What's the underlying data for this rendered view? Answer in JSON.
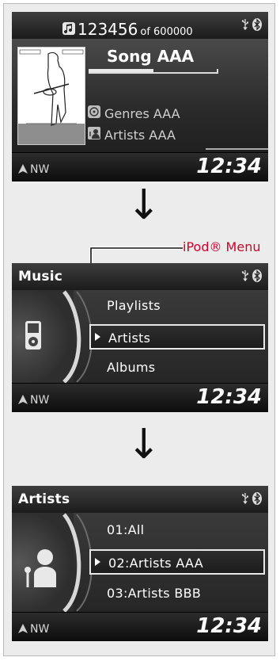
{
  "screens": {
    "now_playing": {
      "track_number": "123456",
      "track_of": "of 600000",
      "song": "Song AAA",
      "genre": "Genres AAA",
      "artist": "Artists AAA",
      "progress": 0.5,
      "compass": "NW",
      "clock": "12:34"
    },
    "music_menu": {
      "title": "Music",
      "items": [
        "Playlists",
        "Artists",
        "Albums"
      ],
      "selected_index": 1,
      "compass": "NW",
      "clock": "12:34"
    },
    "artists_menu": {
      "title": "Artists",
      "items": [
        "01:All",
        "02:Artists AAA",
        "03:Artists BBB"
      ],
      "selected_index": 1,
      "compass": "NW",
      "clock": "12:34"
    }
  },
  "callout": {
    "label": "iPod® Menu",
    "color": "#d2002d"
  },
  "arrow_glyph": "↓",
  "icons": [
    "usb-icon",
    "bluetooth-icon",
    "compass-arrow-icon",
    "music-note-icon",
    "genre-icon",
    "artist-icon",
    "ipod-icon",
    "person-microphone-icon"
  ]
}
